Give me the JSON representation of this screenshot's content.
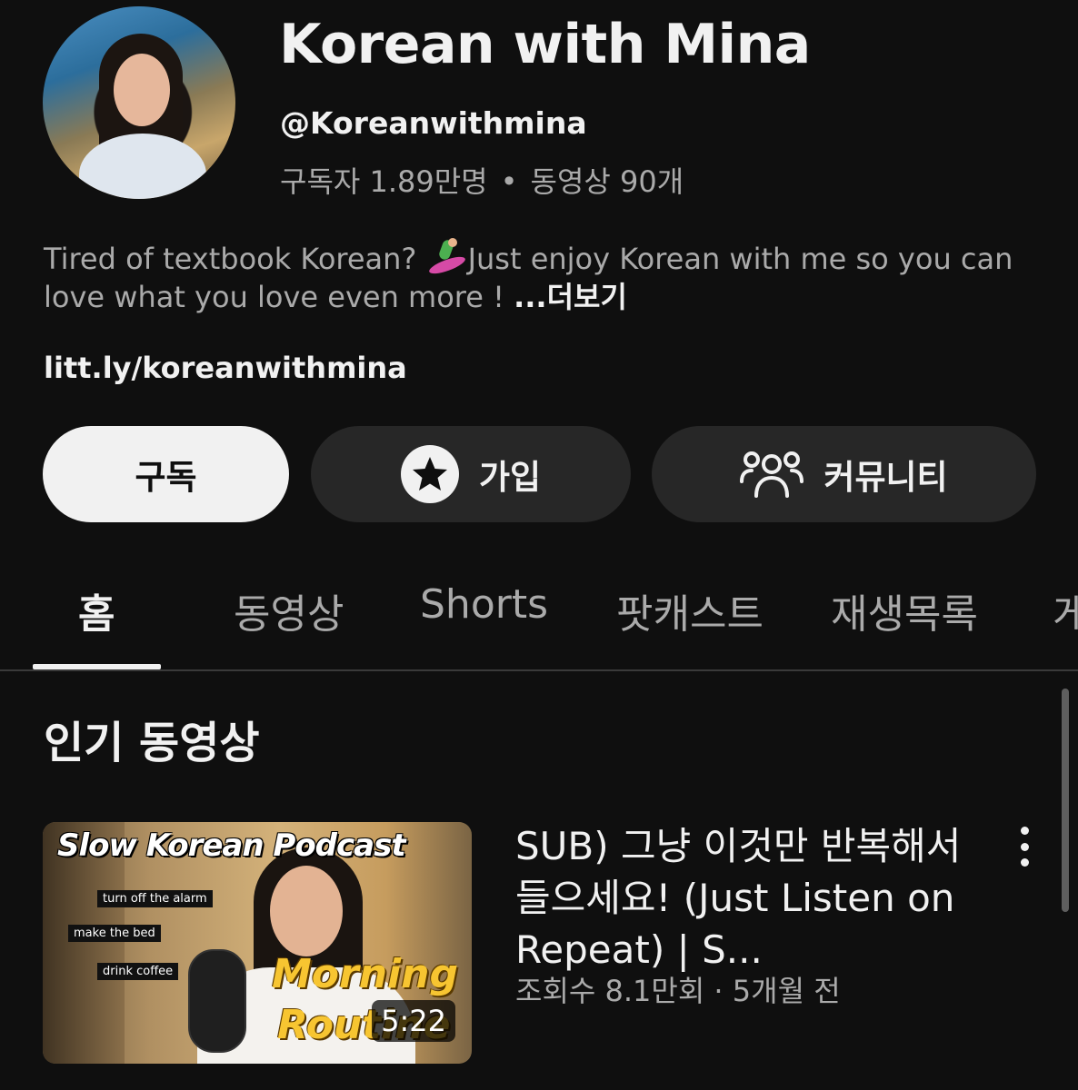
{
  "channel": {
    "title": "Korean with Mina",
    "handle": "@Koreanwithmina",
    "subscribers": "구독자 1.89만명",
    "stats_separator": "•",
    "video_count": "동영상 90개",
    "description_before_emoji": "Tired of textbook Korean? ",
    "description_emoji": "surfer-emoji",
    "description_after_emoji": "Just enjoy Korean with me so you can love what you love even more ! ",
    "more_label": "...더보기",
    "link": "litt.ly/koreanwithmina"
  },
  "actions": {
    "subscribe_label": "구독",
    "join_label": "가입",
    "community_label": "커뮤니티"
  },
  "tabs": [
    {
      "label": "홈",
      "active": true
    },
    {
      "label": "동영상"
    },
    {
      "label": "Shorts"
    },
    {
      "label": "팟캐스트"
    },
    {
      "label": "재생목록"
    },
    {
      "label": "게"
    }
  ],
  "section": {
    "title": "인기 동영상"
  },
  "video": {
    "thumbnail": {
      "title_text": "Slow Korean Podcast",
      "tags": [
        "turn off the alarm",
        "make the bed",
        "drink coffee"
      ],
      "overlay_line1": "Morning",
      "overlay_line2": "Routine",
      "duration": "5:22"
    },
    "title": "SUB) 그냥 이것만 반복해서 들으세요! (Just Listen on Repeat) | S...",
    "meta": "조회수 8.1만회 · 5개월 전"
  }
}
